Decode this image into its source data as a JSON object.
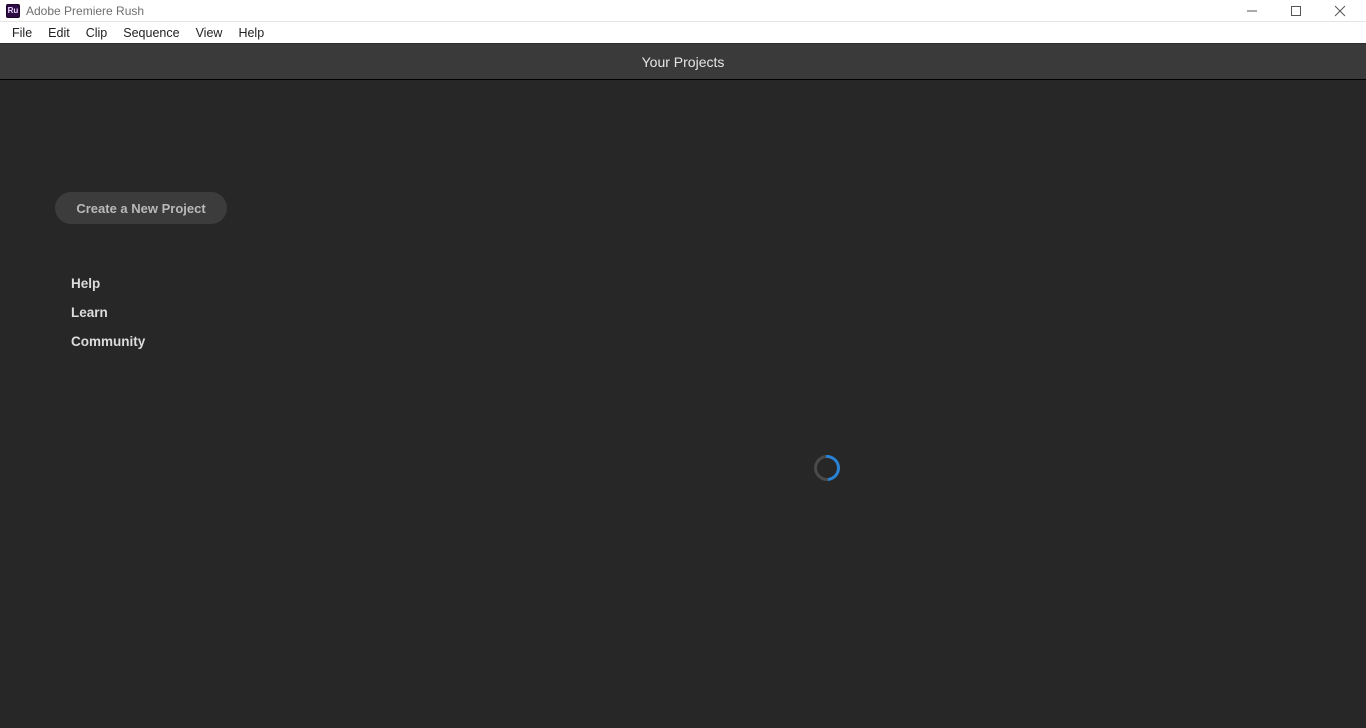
{
  "titlebar": {
    "app_icon_text": "Ru",
    "title": "Adobe Premiere Rush"
  },
  "menubar": {
    "items": [
      "File",
      "Edit",
      "Clip",
      "Sequence",
      "View",
      "Help"
    ]
  },
  "tab_header": {
    "label": "Your Projects"
  },
  "sidebar": {
    "create_button_label": "Create a New Project",
    "links": [
      "Help",
      "Learn",
      "Community"
    ]
  }
}
